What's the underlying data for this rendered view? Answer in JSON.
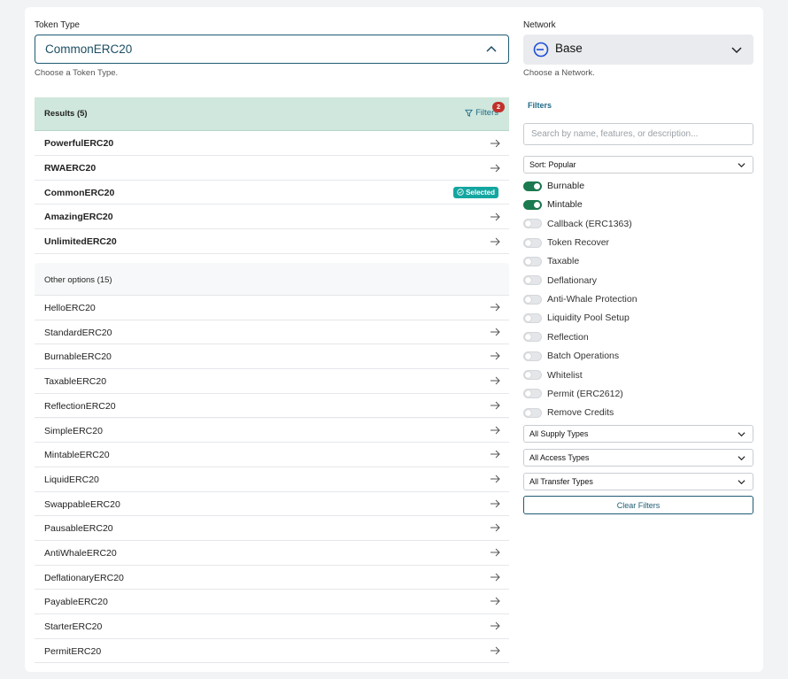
{
  "token_type": {
    "label": "Token Type",
    "value": "CommonERC20",
    "hint": "Choose a Token Type."
  },
  "network": {
    "label": "Network",
    "value": "Base",
    "hint": "Choose a Network."
  },
  "results": {
    "title": "Results (5)",
    "filters_label": "Filters",
    "filter_count": "2",
    "items": [
      {
        "name": "PowerfulERC20",
        "selected": false
      },
      {
        "name": "RWAERC20",
        "selected": false
      },
      {
        "name": "CommonERC20",
        "selected": true
      },
      {
        "name": "AmazingERC20",
        "selected": false
      },
      {
        "name": "UnlimitedERC20",
        "selected": false
      }
    ],
    "selected_label": "Selected"
  },
  "other_options": {
    "title": "Other options (15)",
    "items": [
      "HelloERC20",
      "StandardERC20",
      "BurnableERC20",
      "TaxableERC20",
      "ReflectionERC20",
      "SimpleERC20",
      "MintableERC20",
      "LiquidERC20",
      "SwappableERC20",
      "PausableERC20",
      "AntiWhaleERC20",
      "DeflationaryERC20",
      "PayableERC20",
      "StarterERC20",
      "PermitERC20"
    ]
  },
  "filters": {
    "title": "Filters",
    "search_placeholder": "Search by name, features, or description...",
    "sort": "Sort: Popular",
    "toggles": [
      {
        "label": "Burnable",
        "on": true
      },
      {
        "label": "Mintable",
        "on": true
      },
      {
        "label": "Callback (ERC1363)",
        "on": false
      },
      {
        "label": "Token Recover",
        "on": false
      },
      {
        "label": "Taxable",
        "on": false
      },
      {
        "label": "Deflationary",
        "on": false
      },
      {
        "label": "Anti-Whale Protection",
        "on": false
      },
      {
        "label": "Liquidity Pool Setup",
        "on": false
      },
      {
        "label": "Reflection",
        "on": false
      },
      {
        "label": "Batch Operations",
        "on": false
      },
      {
        "label": "Whitelist",
        "on": false
      },
      {
        "label": "Permit (ERC2612)",
        "on": false
      },
      {
        "label": "Remove Credits",
        "on": false
      }
    ],
    "supply_types": "All Supply Types",
    "access_types": "All Access Types",
    "transfer_types": "All Transfer Types",
    "clear_label": "Clear Filters"
  },
  "colors": {
    "accent": "#1f5b73",
    "results_header": "#cfe7dc",
    "toggle_on": "#1b7a4f",
    "badge": "#c0312b",
    "selected_badge": "#14a6a0"
  }
}
